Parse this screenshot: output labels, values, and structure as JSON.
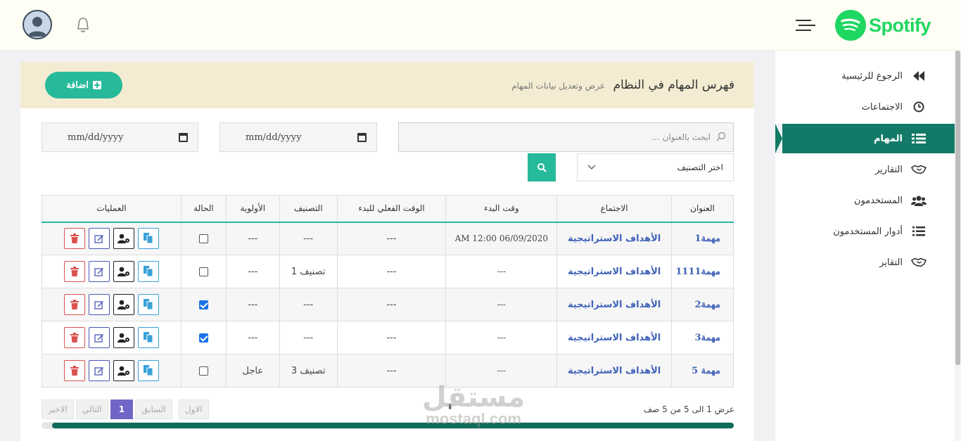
{
  "header": {
    "logo_text": "Spotify",
    "brand_color": "#1ed760"
  },
  "sidebar": {
    "active_color": "#127a67",
    "items": [
      {
        "label": "الرجوع للرئيسية",
        "icon": "fast-backward-icon"
      },
      {
        "label": "الاجتماعات",
        "icon": "clock-icon"
      },
      {
        "label": "المهام",
        "icon": "list-icon",
        "active": true
      },
      {
        "label": "التقارير",
        "icon": "handshake-icon"
      },
      {
        "label": "المستخدمون",
        "icon": "users-icon"
      },
      {
        "label": "أدوار المستخدمون",
        "icon": "list-ol-icon"
      },
      {
        "label": "التقاير",
        "icon": "handshake-icon"
      }
    ]
  },
  "panel": {
    "title": "فهرس المهام في النظام",
    "subtitle": "عرض وتعديل بيانات المهام",
    "add_label": "اضافة",
    "accent_color": "#26b99a"
  },
  "filters": {
    "date_from": "mm/dd/yyyy",
    "date_to": "mm/dd/yyyy",
    "search_placeholder": "ابحث بالعنوان ...",
    "category_select": "اختر التصنيف"
  },
  "table": {
    "headers": [
      "العنوان",
      "الاجتماع",
      "وقت البدء",
      "الوقت الفعلي للبدء",
      "التصنيف",
      "الأولوية",
      "الحالة",
      "العمليات"
    ],
    "rows": [
      {
        "title": "مهمة1",
        "meeting": "الأهداف الاستراتيجية",
        "start": "06/09/2020 12:00 AM",
        "actual_start": "---",
        "category": "---",
        "priority": "---",
        "done": false
      },
      {
        "title": "مهمة1111",
        "meeting": "الأهداف الاستراتيجية",
        "start": "---",
        "actual_start": "---",
        "category": "تصنيف 1",
        "priority": "---",
        "done": false
      },
      {
        "title": "مهمة2",
        "meeting": "الأهداف الاستراتيجية",
        "start": "---",
        "actual_start": "---",
        "category": "---",
        "priority": "---",
        "done": true
      },
      {
        "title": "مهمة3",
        "meeting": "الأهداف الاستراتيجية",
        "start": "---",
        "actual_start": "---",
        "category": "---",
        "priority": "---",
        "done": true
      },
      {
        "title": "مهمة 5",
        "meeting": "الأهداف الاستراتيجية",
        "start": "---",
        "actual_start": "---",
        "category": "تصنيف 3",
        "priority": "عاجل",
        "done": false
      }
    ]
  },
  "footer": {
    "info": "عرض 1 الى 5 من 5 صف",
    "pager": {
      "first": "الاول",
      "prev": "السابق",
      "current": "1",
      "next": "التالي",
      "last": "الاخير"
    }
  },
  "watermark": {
    "line1": "مستقل",
    "line2": "mostaql.com"
  }
}
